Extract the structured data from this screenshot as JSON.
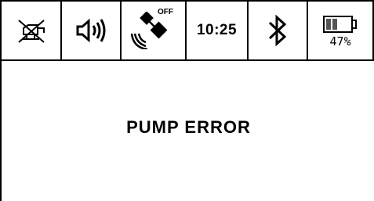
{
  "status_bar": {
    "icons": {
      "pump_suspended": "crossed-pump-icon",
      "sound": "speaker-sound-icon",
      "gps": "satellite-icon",
      "bluetooth": "bluetooth-icon",
      "battery": "battery-icon"
    },
    "gps_state": "OFF",
    "time": "10:25",
    "battery_level": 0.47,
    "battery_percent": "47%"
  },
  "main": {
    "error_message": "PUMP ERROR"
  }
}
